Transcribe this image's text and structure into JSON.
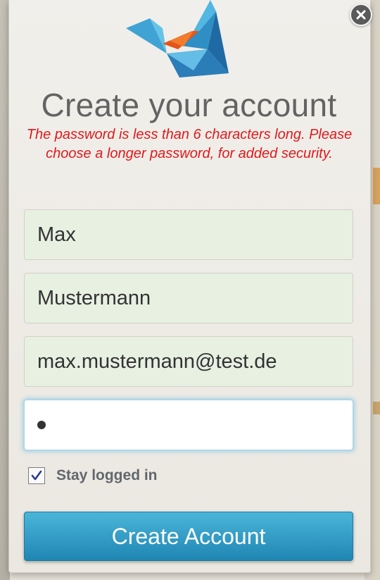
{
  "modal": {
    "title": "Create your account",
    "error_message": "The password is less than 6 characters long. Please choose a longer password, for added security.",
    "close_icon": "close-icon",
    "logo_icon": "paper-crane-logo"
  },
  "form": {
    "first_name": "Max",
    "last_name": "Mustermann",
    "email": "max.mustermann@test.de",
    "password_masked": "●",
    "stay_logged_in_label": "Stay logged in",
    "stay_logged_in_checked": true,
    "submit_label": "Create Account"
  },
  "colors": {
    "error": "#e0191c",
    "button": "#2a98c4",
    "field_filled_bg": "#e7f0e1"
  }
}
